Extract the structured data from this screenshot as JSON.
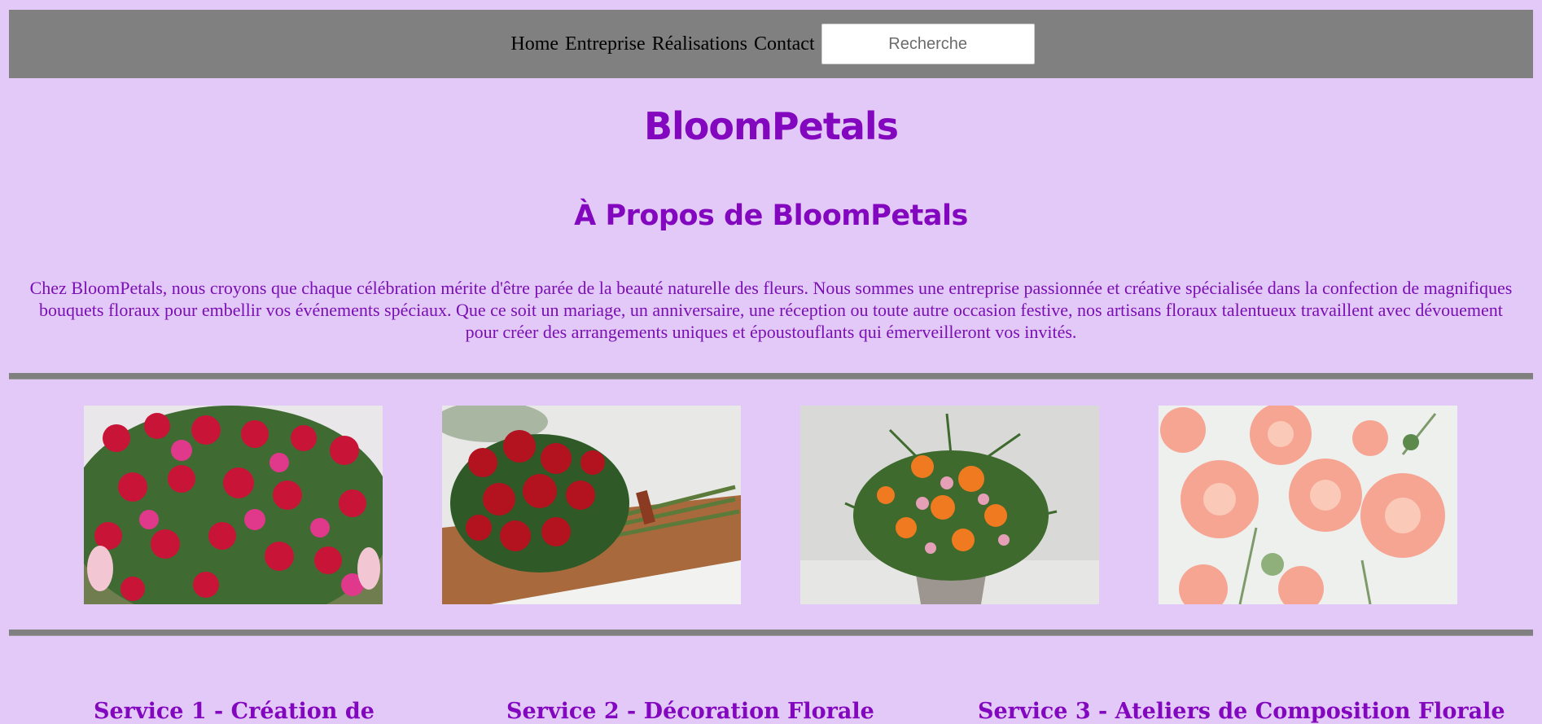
{
  "nav": {
    "links": [
      "Home",
      "Entreprise",
      "Réalisations",
      "Contact"
    ],
    "search_placeholder": "Recherche"
  },
  "header": {
    "title": "BloomPetals"
  },
  "about": {
    "title": "À Propos de BloomPetals",
    "text": "Chez BloomPetals, nous croyons que chaque célébration mérite d'être parée de la beauté naturelle des fleurs. Nous sommes une entreprise passionnée et créative spécialisée dans la confection de magnifiques bouquets floraux pour embellir vos événements spéciaux. Que ce soit un mariage, un anniversaire, une réception ou toute autre occasion festive, nos artisans floraux talentueux travaillent avec dévouement pour créer des arrangements uniques et époustouflants qui émerveilleront vos invités."
  },
  "gallery": {
    "images": [
      "rose-bouquet-image",
      "red-roses-bouquet-image",
      "orange-bouquet-image",
      "pink-dahlias-image"
    ]
  },
  "services": {
    "items": [
      "Service 1 - Création de",
      "Service 2 - Décoration Florale",
      "Service 3 - Ateliers de Composition Florale"
    ]
  },
  "colors": {
    "background": "#e3c9f7",
    "navbar": "#808080",
    "accent": "#8307bf"
  }
}
